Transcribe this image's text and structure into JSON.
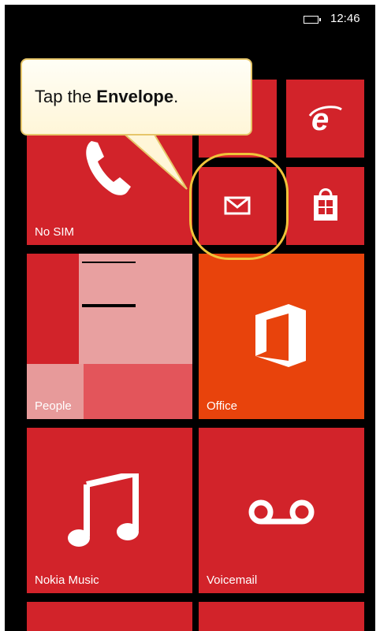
{
  "status_bar": {
    "time": "12:46"
  },
  "callout": {
    "prefix": "Tap the ",
    "emphasis": "Envelope",
    "suffix": "."
  },
  "tiles": {
    "phone": {
      "label": "No SIM"
    },
    "people": {
      "label": "People"
    },
    "office": {
      "label": "Office"
    },
    "music": {
      "label": "Nokia Music"
    },
    "voicemail": {
      "label": "Voicemail"
    }
  },
  "icons": {
    "phone": "phone-icon",
    "ie": "internet-explorer-icon",
    "mail": "envelope-icon",
    "store": "store-icon",
    "office": "office-icon",
    "music": "music-note-icon",
    "voicemail": "voicemail-icon",
    "battery": "battery-icon"
  },
  "colors": {
    "tile_red": "#d2232a",
    "office_orange": "#e8430c",
    "callout_border": "#e7c66a",
    "highlight_ring": "#f0c43a"
  }
}
